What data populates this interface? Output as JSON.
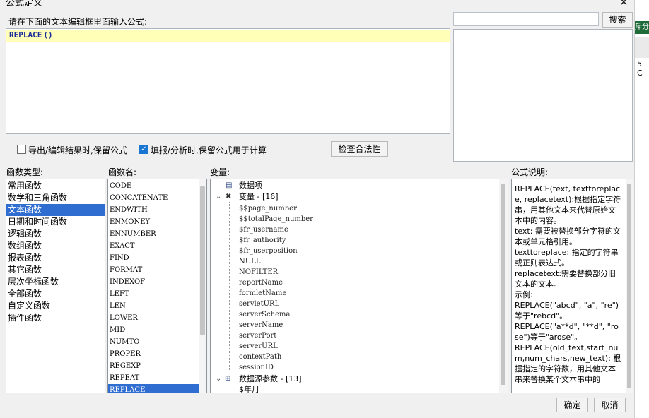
{
  "window": {
    "title": "公式定义",
    "close_glyph": "✕"
  },
  "editor": {
    "instruction": "请在下面的文本编辑框里面输入公式:",
    "formula_name": "REPLACE",
    "formula_paren": "()"
  },
  "search": {
    "value": "",
    "button_label": "搜索"
  },
  "options": {
    "export_keep_label": "导出/编辑结果时,保留公式",
    "export_keep_checked": false,
    "fill_keep_label": "填报/分析时,保留公式用于计算",
    "fill_keep_checked": true,
    "check_button": "检查合法性"
  },
  "function_types": {
    "header": "函数类型:",
    "items": [
      "常用函数",
      "数学和三角函数",
      "文本函数",
      "日期和时间函数",
      "逻辑函数",
      "数组函数",
      "报表函数",
      "其它函数",
      "层次坐标函数",
      "全部函数",
      "自定义函数",
      "插件函数"
    ],
    "selected": "文本函数"
  },
  "function_names": {
    "header": "函数名:",
    "items": [
      "CODE",
      "CONCATENATE",
      "ENDWITH",
      "ENMONEY",
      "ENNUMBER",
      "EXACT",
      "FIND",
      "FORMAT",
      "INDEXOF",
      "LEFT",
      "LEN",
      "LOWER",
      "MID",
      "NUMTO",
      "PROPER",
      "REGEXP",
      "REPEAT",
      "REPLACE"
    ],
    "selected": "REPLACE"
  },
  "variables": {
    "header": "变量:",
    "root_label": "数据项",
    "group_vars_label": "变量 - [16]",
    "vars": [
      "$$page_number",
      "$$totalPage_number",
      "$fr_username",
      "$fr_authority",
      "$fr_userposition",
      "NULL",
      "NOFILTER",
      "reportName",
      "formletName",
      "servletURL",
      "serverSchema",
      "serverName",
      "serverPort",
      "serverURL",
      "contextPath",
      "sessionID"
    ],
    "group_params_label": "数据源参数 - [13]",
    "params": [
      "$年月"
    ]
  },
  "description": {
    "header": "公式说明:",
    "lines": [
      {
        "text": "REPLACE(text, texttoreplace, replacetext):根据指定字符串，用其他文本来代替原始文本中的内容。"
      },
      {
        "text": "text: 需要被替换部分字符的文本或单元格引用。"
      },
      {
        "text": "texttoreplace: 指定的字符串或正则表达式。"
      },
      {
        "text": "replacetext:需要替换部分旧文本的文本。"
      },
      {
        "text": "示例:"
      },
      {
        "text": "REPLACE(\"abcd\", \"a\", \"re\")等于\"rebcd\"。"
      },
      {
        "text": "REPLACE(\"a**d\", \"**d\", \"rose\")等于\"arose\"。"
      },
      {
        "text": "REPLACE(old_text,start_num,num_chars,new_text): 根据指定的字符数，用其他文本串来替换某个文本串中的"
      }
    ]
  },
  "footer": {
    "ok_label": "确定",
    "cancel_label": "取消"
  },
  "background_hints": {
    "top_right": "斥分",
    "mid_right": "5 C"
  },
  "colors": {
    "selection": "#2f6dd0",
    "formula_line": "#ffffb8",
    "formula_text": "#1a2c9a",
    "checkbox_on": "#1976d2"
  }
}
